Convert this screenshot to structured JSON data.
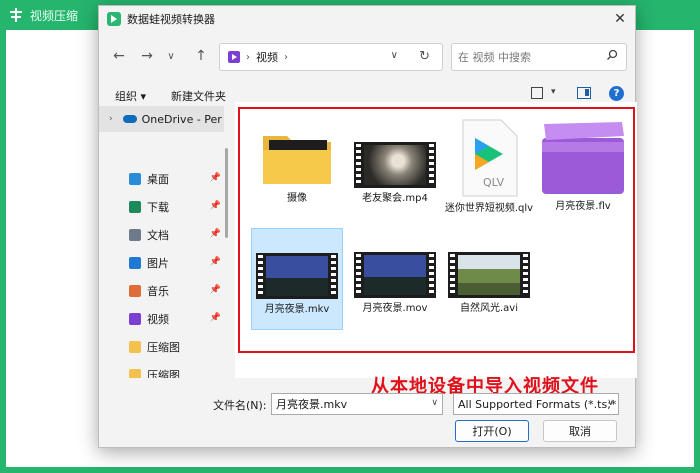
{
  "app": {
    "title": "视频压缩"
  },
  "dialog": {
    "title": "数据蛙视频转换器",
    "close_label": "✕"
  },
  "nav": {
    "address": "视频",
    "search_placeholder": "在 视频 中搜索"
  },
  "toolbar": {
    "organize": "组织 ▾",
    "new_folder": "新建文件夹"
  },
  "sidebar": {
    "onedrive": "OneDrive - Per",
    "items": [
      {
        "label": "桌面",
        "icon": "desktop-icon",
        "color": "#2a8bd8",
        "pinned": true
      },
      {
        "label": "下载",
        "icon": "download-icon",
        "color": "#1e8a5c",
        "pinned": true
      },
      {
        "label": "文档",
        "icon": "document-icon",
        "color": "#6c7a89",
        "pinned": true
      },
      {
        "label": "图片",
        "icon": "pictures-icon",
        "color": "#1f78d1",
        "pinned": true
      },
      {
        "label": "音乐",
        "icon": "music-icon",
        "color": "#e06c3a",
        "pinned": true
      },
      {
        "label": "视频",
        "icon": "video-folder-icon",
        "color": "#7b3fd1",
        "pinned": true
      },
      {
        "label": "压缩图",
        "icon": "folder-icon",
        "color": "#f2c14e",
        "pinned": false
      },
      {
        "label": "压缩图",
        "icon": "folder-icon",
        "color": "#f2c14e",
        "pinned": false
      }
    ]
  },
  "files": [
    {
      "name": "摄像",
      "kind": "folder"
    },
    {
      "name": "老友聚会.mp4",
      "kind": "video"
    },
    {
      "name": "迷你世界短视频.qlv",
      "kind": "qlv"
    },
    {
      "name": "月亮夜景.flv",
      "kind": "flv"
    },
    {
      "name": "月亮夜景.mkv",
      "kind": "video",
      "selected": true
    },
    {
      "name": "月亮夜景.mov",
      "kind": "video"
    },
    {
      "name": "自然风光.avi",
      "kind": "video"
    }
  ],
  "qlv_badge": "QLV",
  "callout": "从本地设备中导入视频文件",
  "bottom": {
    "filename_label": "文件名(N):",
    "filename_value": "月亮夜景.mkv",
    "format_value": "All Supported Formats (*.ts;*",
    "open_label": "打开(O)",
    "cancel_label": "取消"
  },
  "colors": {
    "app_green": "#25b56d",
    "highlight_red": "#e0111b",
    "selection": "#cce8ff",
    "accent_blue": "#1f6fd1"
  }
}
